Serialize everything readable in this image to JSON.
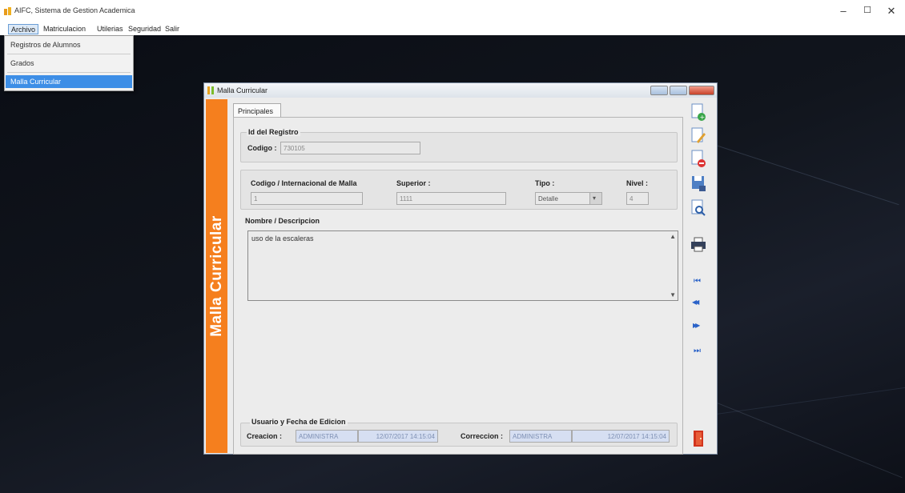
{
  "app": {
    "title": "AIFC, Sistema de Gestion Academica",
    "controls": {
      "minimize": "–",
      "maximize": "☐",
      "close": "✕"
    }
  },
  "menu": {
    "items": [
      "Archivo",
      "Matriculacion",
      "Utilerias",
      "Seguridad",
      "Salir"
    ]
  },
  "dropdown": {
    "items": [
      "Registros de Alumnos",
      "Grados",
      "Malla Curricular"
    ]
  },
  "frame": {
    "title": "Malla Curricular",
    "banner": "Malla Curricular",
    "tab": "Principales"
  },
  "form": {
    "id_group_title": "Id del Registro",
    "codigo_label": "Codigo :",
    "codigo_value": "730105",
    "codigo_int_label": "Codigo / Internacional de Malla",
    "codigo_int_value": "1",
    "superior_label": "Superior :",
    "superior_value": "1111",
    "tipo_label": "Tipo :",
    "tipo_value": "Detalle",
    "nivel_label": "Nivel :",
    "nivel_value": "4",
    "descripcion_label": "Nombre / Descripcion",
    "descripcion_value": "uso de la escaleras",
    "audit_group_title": "Usuario y Fecha de Edicion",
    "creacion_label": "Creacion :",
    "creacion_user": "ADMINISTRA",
    "creacion_date": "12/07/2017 14:15:04",
    "correccion_label": "Correccion :",
    "correccion_user": "ADMINISTRA",
    "correccion_date": "12/07/2017 14:15:04"
  },
  "toolbar": {
    "icons": [
      "new-record-icon",
      "edit-icon",
      "delete-icon",
      "save-icon",
      "search-icon",
      "print-icon",
      "first-record-icon",
      "previous-record-icon",
      "next-record-icon",
      "last-record-icon",
      "exit-door-icon"
    ],
    "nav_glyphs": {
      "first": "⏮",
      "prev": "◀◀",
      "next": "▶▶",
      "last": "⏭"
    }
  },
  "colors": {
    "banner": "#f57f1e",
    "selection": "#3d8ee6",
    "audit_field": "#d6dff2"
  }
}
